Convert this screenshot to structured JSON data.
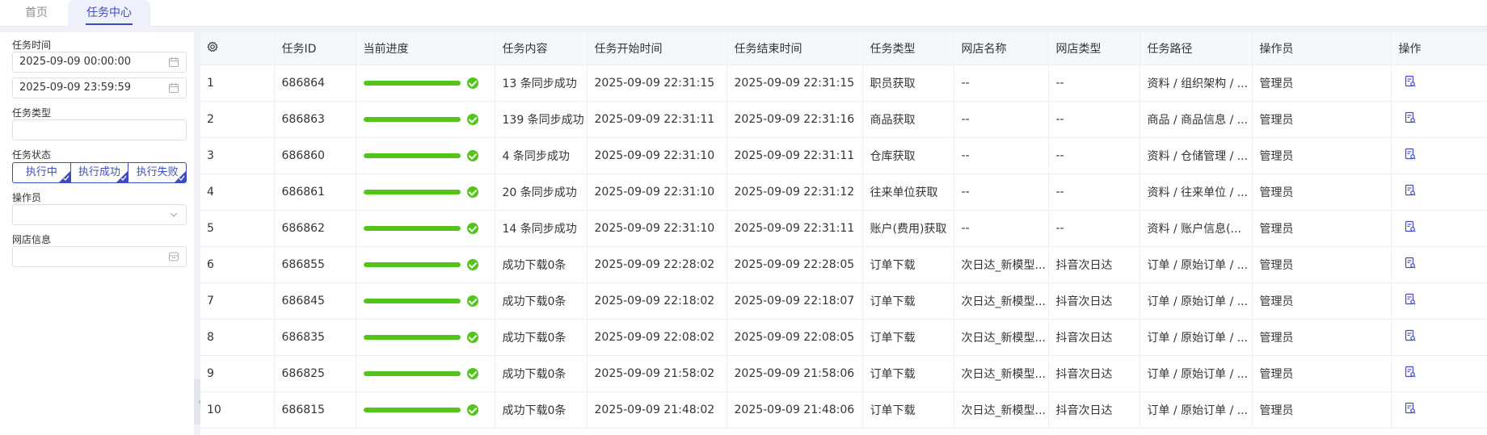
{
  "tabs": {
    "home": "首页",
    "task_center": "任务中心"
  },
  "filters": {
    "time_label": "任务时间",
    "start_time": "2025-09-09 00:00:00",
    "end_time": "2025-09-09 23:59:59",
    "type_label": "任务类型",
    "type_value": "",
    "status_label": "任务状态",
    "status_options": [
      "执行中",
      "执行成功",
      "执行失败"
    ],
    "operator_label": "操作员",
    "operator_value": "",
    "shop_label": "网店信息",
    "shop_value": ""
  },
  "colors": {
    "accent": "#3d4dbf",
    "progress": "#52c41a"
  },
  "table": {
    "columns": [
      "",
      "任务ID",
      "当前进度",
      "任务内容",
      "任务开始时间",
      "任务结束时间",
      "任务类型",
      "网店名称",
      "网店类型",
      "任务路径",
      "操作员",
      "操作"
    ],
    "rows": [
      {
        "no": "1",
        "id": "686864",
        "progress": 1.0,
        "content": "13 条同步成功",
        "start": "2025-09-09 22:31:15",
        "end": "2025-09-09 22:31:15",
        "type": "职员获取",
        "shop": "--",
        "shop_type": "--",
        "path": "资料 / 组织架构 / ...",
        "operator": "管理员"
      },
      {
        "no": "2",
        "id": "686863",
        "progress": 1.0,
        "content": "139 条同步成功",
        "start": "2025-09-09 22:31:11",
        "end": "2025-09-09 22:31:16",
        "type": "商品获取",
        "shop": "--",
        "shop_type": "--",
        "path": "商品 / 商品信息 / ...",
        "operator": "管理员"
      },
      {
        "no": "3",
        "id": "686860",
        "progress": 1.0,
        "content": "4 条同步成功",
        "start": "2025-09-09 22:31:10",
        "end": "2025-09-09 22:31:11",
        "type": "仓库获取",
        "shop": "--",
        "shop_type": "--",
        "path": "资料 / 仓储管理 / ...",
        "operator": "管理员"
      },
      {
        "no": "4",
        "id": "686861",
        "progress": 1.0,
        "content": "20 条同步成功",
        "start": "2025-09-09 22:31:10",
        "end": "2025-09-09 22:31:12",
        "type": "往来单位获取",
        "shop": "--",
        "shop_type": "--",
        "path": "资料 / 往来单位 / ...",
        "operator": "管理员"
      },
      {
        "no": "5",
        "id": "686862",
        "progress": 1.0,
        "content": "14 条同步成功",
        "start": "2025-09-09 22:31:10",
        "end": "2025-09-09 22:31:11",
        "type": "账户(费用)获取",
        "shop": "--",
        "shop_type": "--",
        "path": "资料 / 账户信息(...",
        "operator": "管理员"
      },
      {
        "no": "6",
        "id": "686855",
        "progress": 1.0,
        "content": "成功下载0条",
        "start": "2025-09-09 22:28:02",
        "end": "2025-09-09 22:28:05",
        "type": "订单下载",
        "shop": "次日达_新模型...",
        "shop_type": "抖音次日达",
        "path": "订单 / 原始订单 / ...",
        "operator": "管理员"
      },
      {
        "no": "7",
        "id": "686845",
        "progress": 1.0,
        "content": "成功下载0条",
        "start": "2025-09-09 22:18:02",
        "end": "2025-09-09 22:18:07",
        "type": "订单下载",
        "shop": "次日达_新模型...",
        "shop_type": "抖音次日达",
        "path": "订单 / 原始订单 / ...",
        "operator": "管理员"
      },
      {
        "no": "8",
        "id": "686835",
        "progress": 1.0,
        "content": "成功下载0条",
        "start": "2025-09-09 22:08:02",
        "end": "2025-09-09 22:08:05",
        "type": "订单下载",
        "shop": "次日达_新模型...",
        "shop_type": "抖音次日达",
        "path": "订单 / 原始订单 / ...",
        "operator": "管理员"
      },
      {
        "no": "9",
        "id": "686825",
        "progress": 1.0,
        "content": "成功下载0条",
        "start": "2025-09-09 21:58:02",
        "end": "2025-09-09 21:58:06",
        "type": "订单下载",
        "shop": "次日达_新模型...",
        "shop_type": "抖音次日达",
        "path": "订单 / 原始订单 / ...",
        "operator": "管理员"
      },
      {
        "no": "10",
        "id": "686815",
        "progress": 1.0,
        "content": "成功下载0条",
        "start": "2025-09-09 21:48:02",
        "end": "2025-09-09 21:48:06",
        "type": "订单下载",
        "shop": "次日达_新模型...",
        "shop_type": "抖音次日达",
        "path": "订单 / 原始订单 / ...",
        "operator": "管理员"
      }
    ]
  }
}
